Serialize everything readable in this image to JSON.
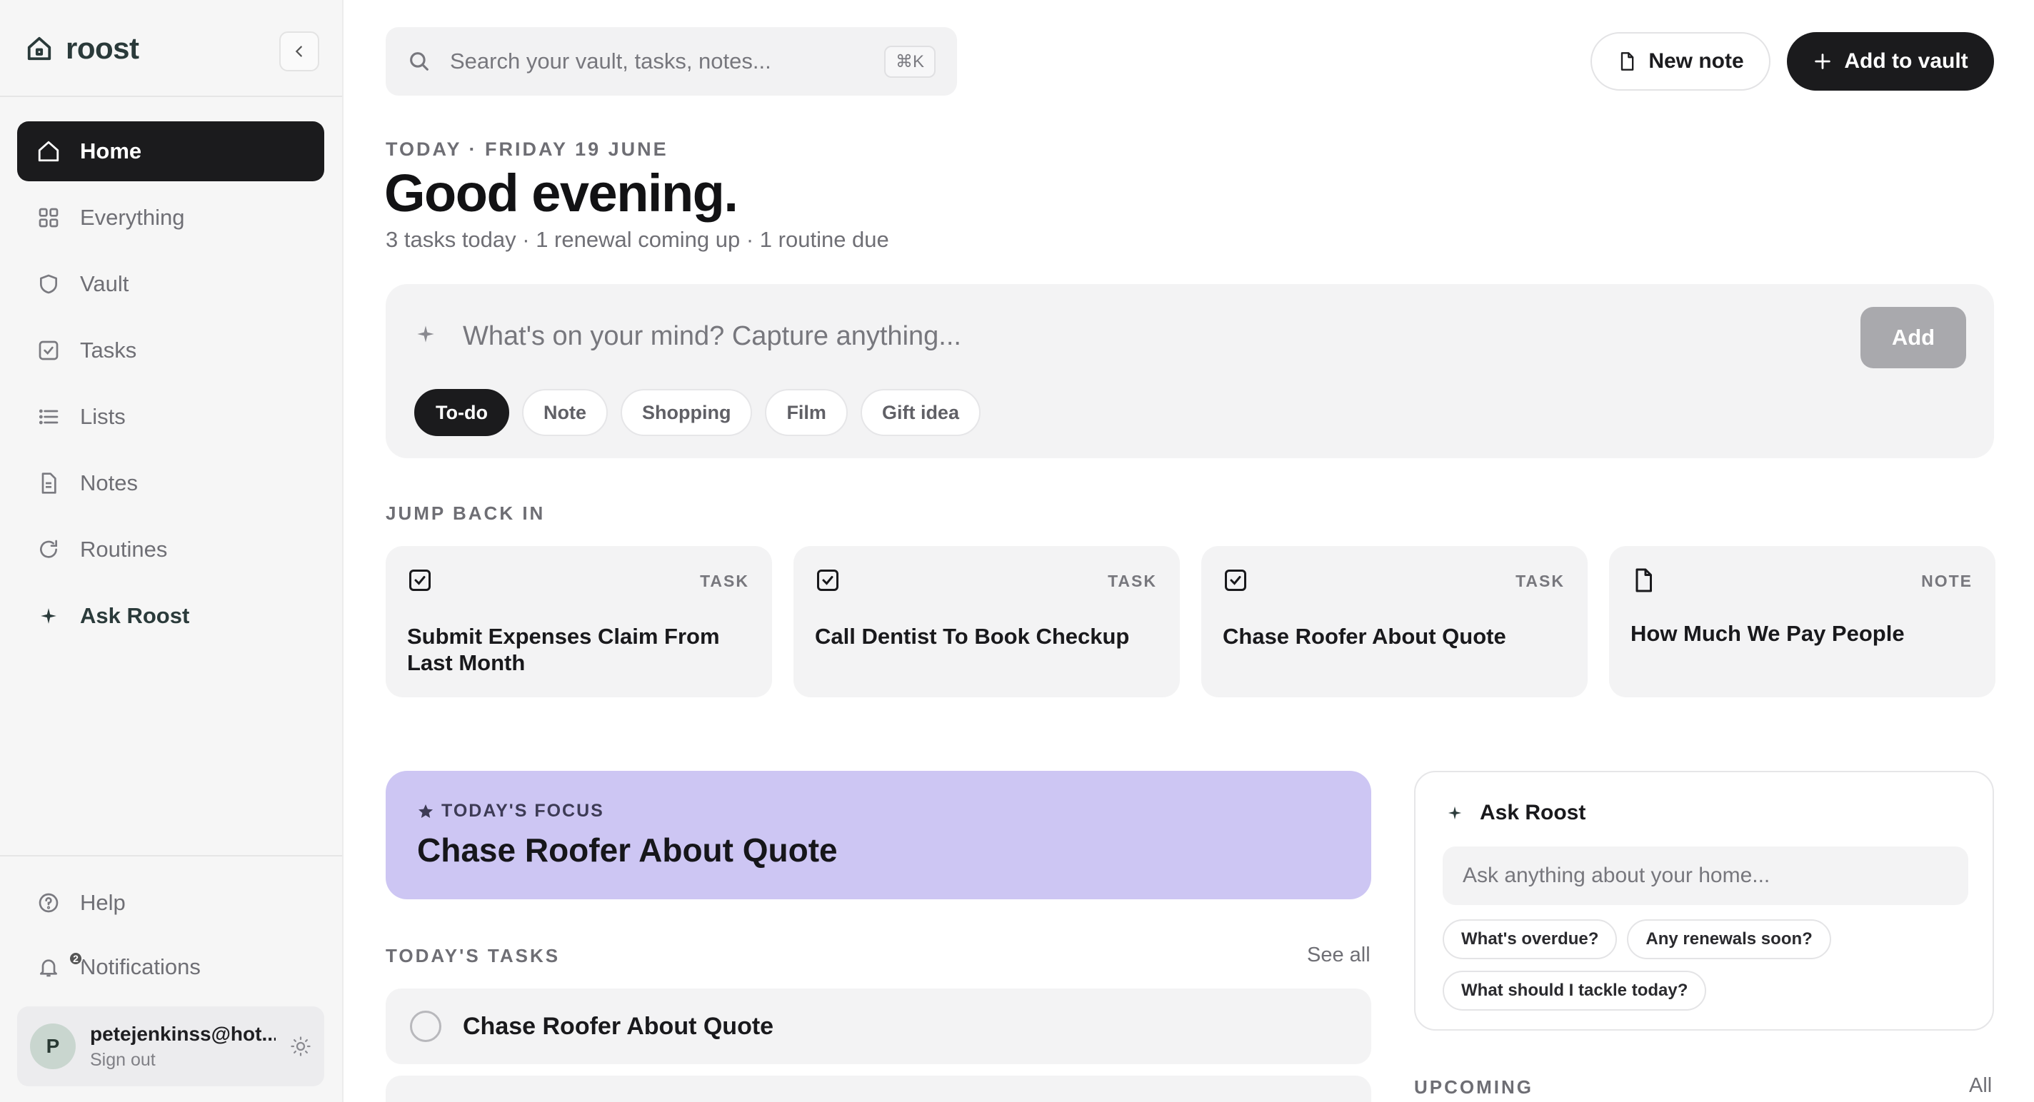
{
  "sidebar": {
    "brand": "roost",
    "items": [
      {
        "label": "Home"
      },
      {
        "label": "Everything"
      },
      {
        "label": "Vault"
      },
      {
        "label": "Tasks"
      },
      {
        "label": "Lists"
      },
      {
        "label": "Notes"
      },
      {
        "label": "Routines"
      },
      {
        "label": "Ask Roost"
      }
    ],
    "bottom": [
      {
        "label": "Help"
      },
      {
        "label": "Notifications",
        "badge": "2"
      }
    ],
    "user": {
      "initial": "P",
      "email": "petejenkinss@hot...",
      "sign_out": "Sign out"
    }
  },
  "header": {
    "search_placeholder": "Search your vault, tasks, notes...",
    "shortcut": "⌘K",
    "new_note": "New note",
    "add_to_vault": "Add to vault"
  },
  "greeting": {
    "date": "TODAY · FRIDAY 19 JUNE",
    "title": "Good evening.",
    "summary": "3 tasks today · 1 renewal coming up · 1 routine due"
  },
  "capture": {
    "placeholder": "What's on your mind? Capture anything...",
    "add": "Add",
    "chips": [
      "To-do",
      "Note",
      "Shopping",
      "Film",
      "Gift idea"
    ]
  },
  "jump_back": {
    "label": "JUMP BACK IN",
    "cards": [
      {
        "type": "TASK",
        "title": "Submit Expenses Claim From Last Month"
      },
      {
        "type": "TASK",
        "title": "Call Dentist To Book Checkup"
      },
      {
        "type": "TASK",
        "title": "Chase Roofer About Quote"
      },
      {
        "type": "NOTE",
        "title": "How Much We Pay People"
      }
    ]
  },
  "focus": {
    "label": "TODAY'S FOCUS",
    "title": "Chase Roofer About Quote"
  },
  "tasks": {
    "label": "TODAY'S TASKS",
    "see_all": "See all",
    "items": [
      {
        "title": "Chase Roofer About Quote"
      }
    ]
  },
  "ask": {
    "title": "Ask Roost",
    "placeholder": "Ask anything about your home...",
    "suggestions": [
      "What's overdue?",
      "Any renewals soon?",
      "What should I tackle today?"
    ]
  },
  "upcoming": {
    "label": "UPCOMING",
    "all": "All"
  },
  "colors": {
    "accent_dark": "#1b1b1d",
    "focus_bg": "#cdc6f3",
    "surface": "#f3f3f4"
  }
}
